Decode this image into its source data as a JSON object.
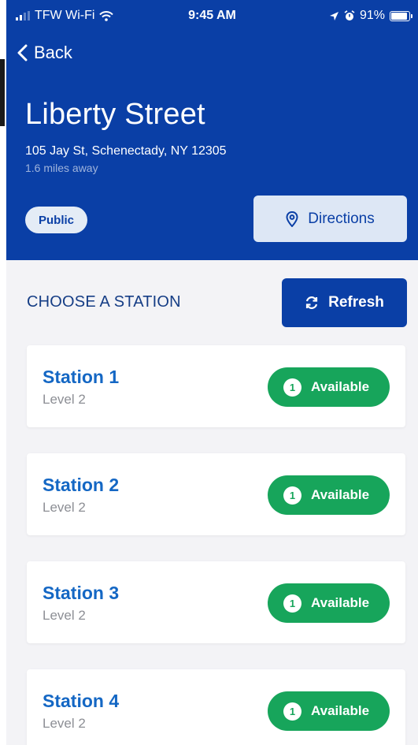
{
  "status_bar": {
    "carrier": "TFW Wi-Fi",
    "time": "9:45 AM",
    "battery": "91%",
    "battery_level": 0.91,
    "icons": [
      "signal-icon",
      "wifi-icon",
      "location-arrow-icon",
      "alarm-icon",
      "battery-icon"
    ]
  },
  "nav": {
    "back_label": "Back"
  },
  "location": {
    "title": "Liberty Street",
    "address": "105 Jay St, Schenectady, NY 12305",
    "distance": "1.6 miles away",
    "access_badge": "Public",
    "directions_label": "Directions"
  },
  "stations_section": {
    "title": "CHOOSE A STATION",
    "refresh_label": "Refresh",
    "stations": [
      {
        "name": "Station 1",
        "level": "Level 2",
        "count": "1",
        "status": "Available"
      },
      {
        "name": "Station 2",
        "level": "Level 2",
        "count": "1",
        "status": "Available"
      },
      {
        "name": "Station 3",
        "level": "Level 2",
        "count": "1",
        "status": "Available"
      },
      {
        "name": "Station 4",
        "level": "Level 2",
        "count": "1",
        "status": "Available"
      }
    ]
  },
  "colors": {
    "primary": "#0a3fa6",
    "available": "#17a55b",
    "station_name": "#1467c4",
    "background": "#f3f3f6"
  }
}
